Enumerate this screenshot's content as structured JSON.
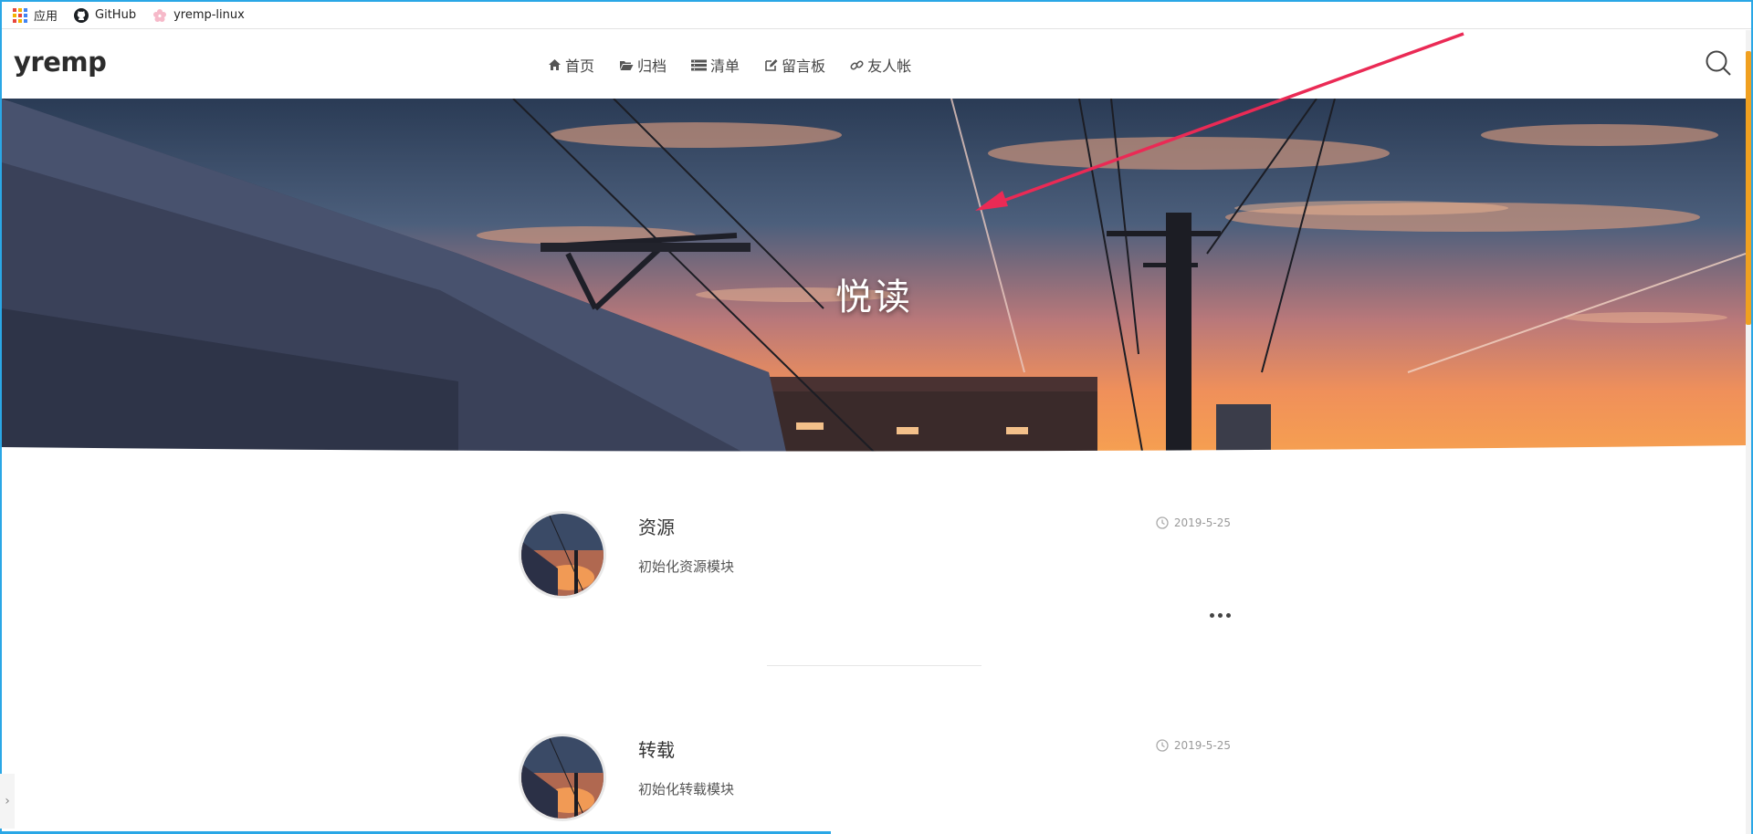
{
  "bookmarks": [
    {
      "label": "应用",
      "icon": "apps-grid-icon"
    },
    {
      "label": "GitHub",
      "icon": "github-icon"
    },
    {
      "label": "yremp-linux",
      "icon": "sakura-icon"
    }
  ],
  "site": {
    "logo": "yremp",
    "nav": [
      {
        "label": "首页",
        "icon": "home-icon"
      },
      {
        "label": "归档",
        "icon": "folder-open-icon"
      },
      {
        "label": "清单",
        "icon": "list-icon"
      },
      {
        "label": "留言板",
        "icon": "edit-icon"
      },
      {
        "label": "友人帐",
        "icon": "link-icon"
      }
    ]
  },
  "hero": {
    "title": "悦读"
  },
  "posts": [
    {
      "title": "资源",
      "excerpt": "初始化资源模块",
      "date": "2019-5-25"
    },
    {
      "title": "转载",
      "excerpt": "初始化转载模块",
      "date": "2019-5-25"
    }
  ],
  "colors": {
    "frame": "#2aa7e6",
    "scrollbar": "#f0a020",
    "annotation_arrow": "#ea2a55"
  }
}
